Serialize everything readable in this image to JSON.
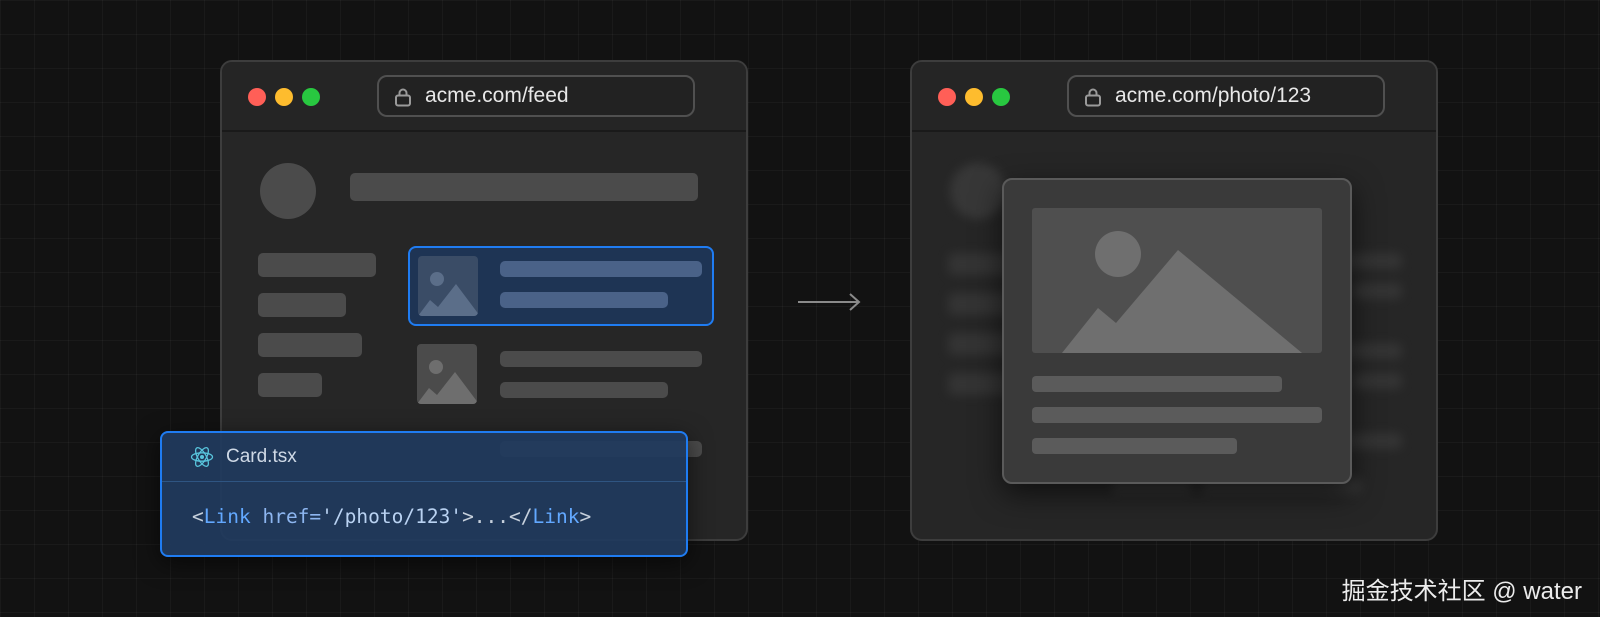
{
  "colors": {
    "background": "#121212",
    "window": "#262626",
    "placeholder": "#4b4b4b",
    "accent_blue": "#1f7cf2",
    "traffic_red": "#ff5f57",
    "traffic_yellow": "#febc2e",
    "traffic_green": "#28c840"
  },
  "left_window": {
    "url": "acme.com/feed",
    "icons": [
      "lock-icon",
      "image-icon"
    ]
  },
  "right_window": {
    "url": "acme.com/photo/123",
    "icons": [
      "lock-icon",
      "image-icon"
    ]
  },
  "code_panel": {
    "filename": "Card.tsx",
    "icon": "react-icon",
    "code": {
      "open_bracket": "<",
      "tag": "Link",
      "attr": " href=",
      "value": "'/photo/123'",
      "middle": ">...</",
      "close_tag": "Link",
      "close_bracket": ">"
    }
  },
  "arrow_icon": "arrow-right-icon",
  "watermark": "掘金技术社区 @ water"
}
